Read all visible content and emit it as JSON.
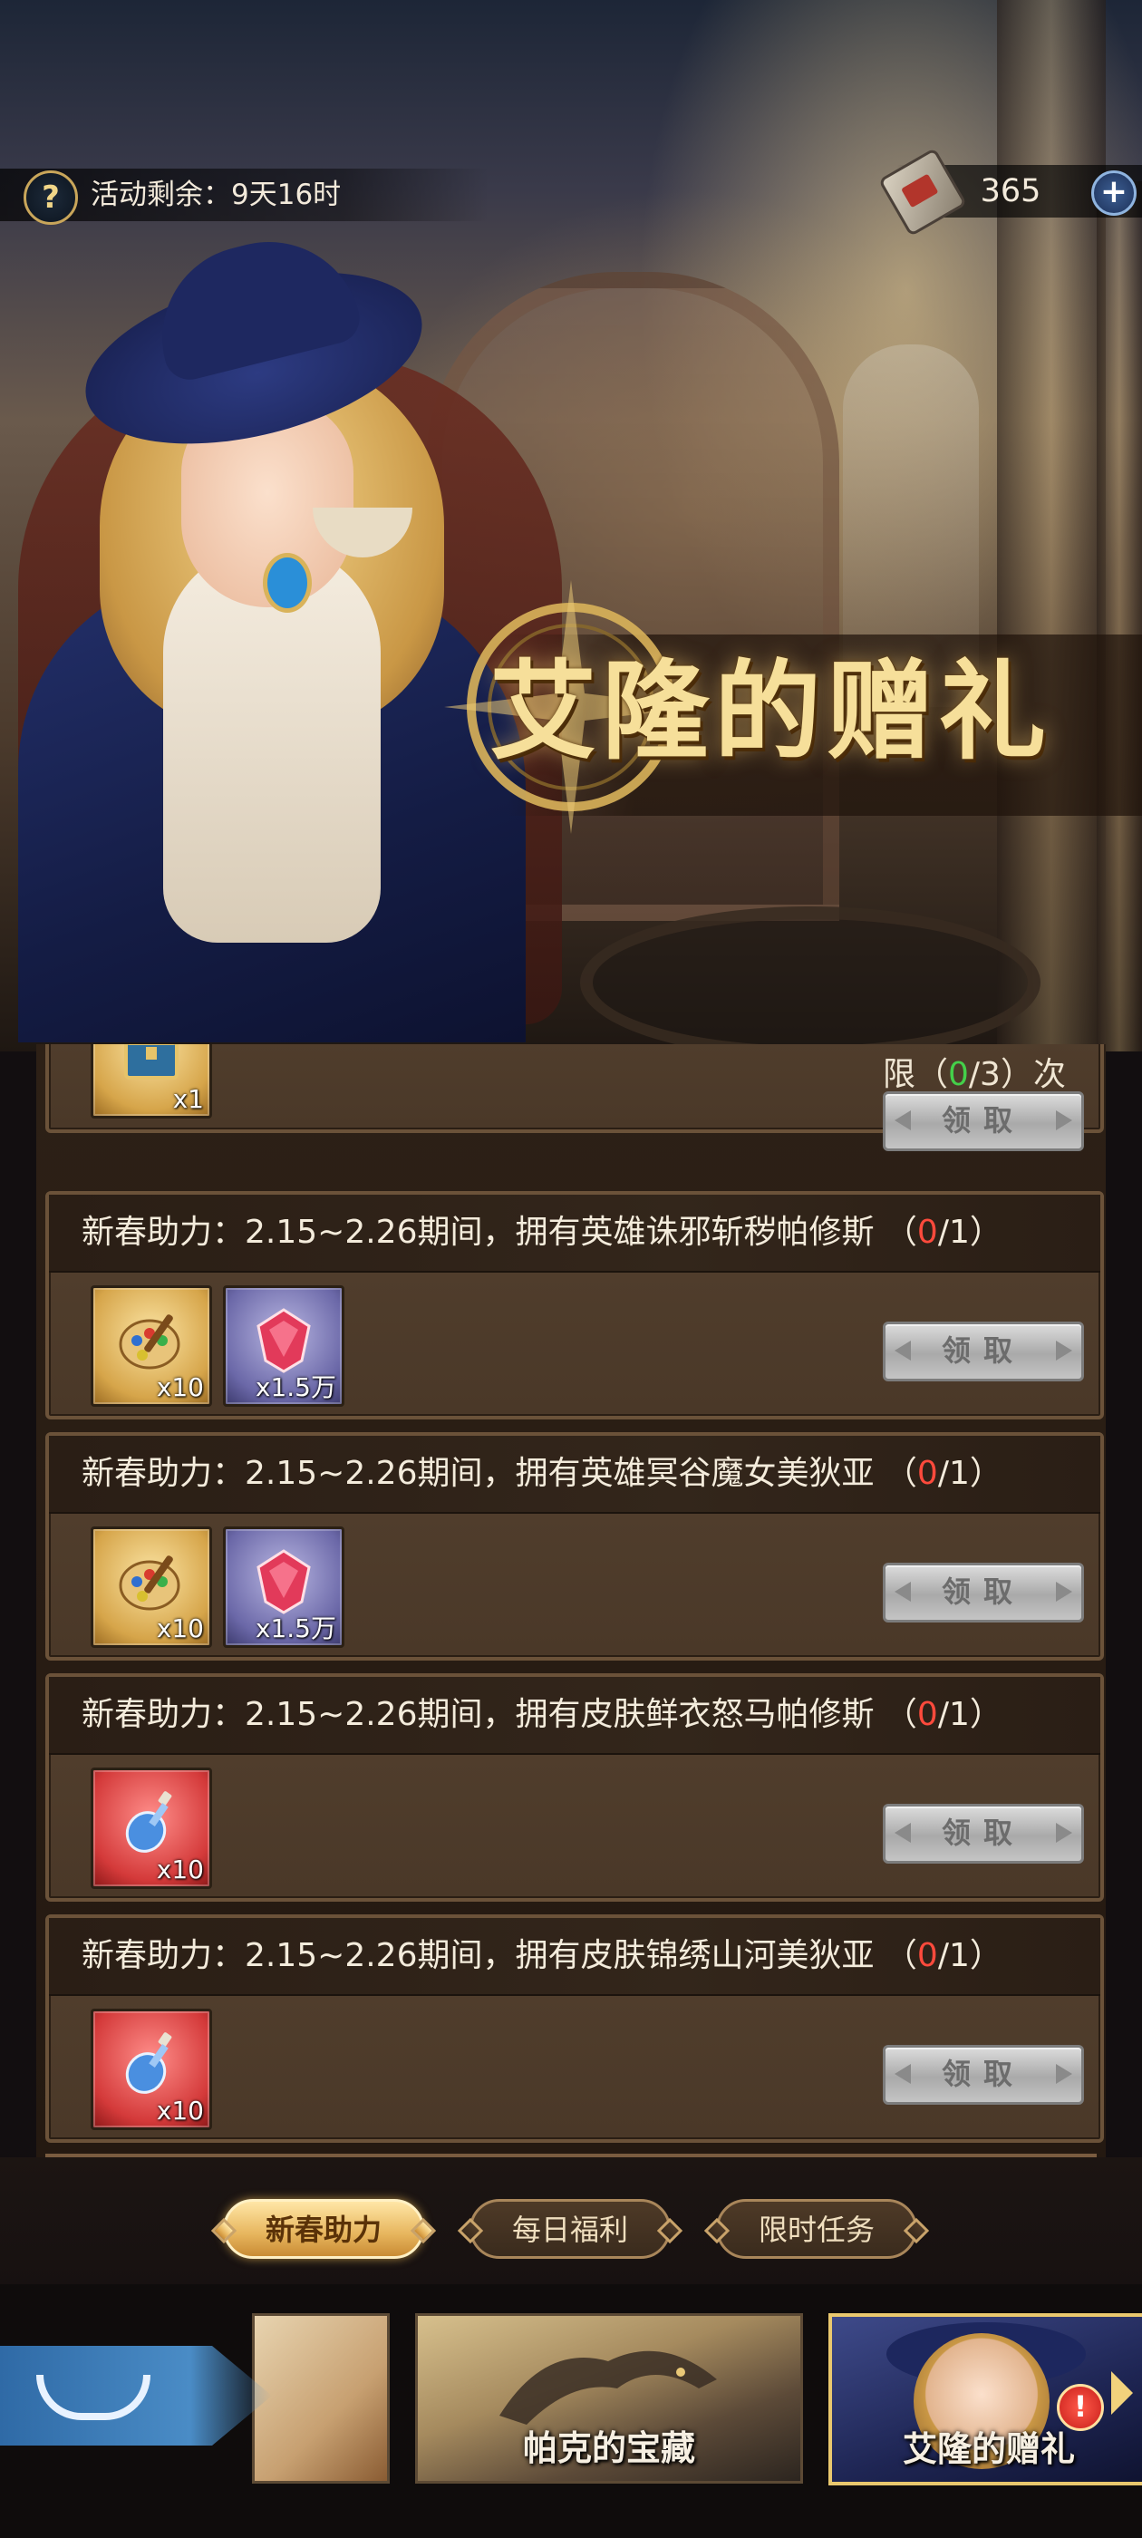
{
  "header": {
    "help_icon": "question-icon",
    "time_remaining": "活动剩余：9天16时",
    "currency_icon": "book-icon",
    "currency_value": "365",
    "add_icon": "plus-icon"
  },
  "banner": {
    "title": "艾隆的赠礼"
  },
  "tasks": [
    {
      "limit_prefix": "限（",
      "limit_cur": "0",
      "limit_suffix": "/3）次",
      "items": [
        {
          "icon": "treasure-chest-icon",
          "qty": "x1"
        }
      ],
      "button": "领取"
    },
    {
      "title": "新春助力：2.15~2.26期间，拥有英雄诛邪斩秽帕修斯 （",
      "progress_cur": "0",
      "progress_rest": "/1）",
      "items": [
        {
          "icon": "paint-palette-icon",
          "qty": "x10"
        },
        {
          "icon": "red-gem-icon",
          "qty": "x1.5万"
        }
      ],
      "button": "领取"
    },
    {
      "title": "新春助力：2.15~2.26期间，拥有英雄冥谷魔女美狄亚 （",
      "progress_cur": "0",
      "progress_rest": "/1）",
      "items": [
        {
          "icon": "paint-palette-icon",
          "qty": "x10"
        },
        {
          "icon": "red-gem-icon",
          "qty": "x1.5万"
        }
      ],
      "button": "领取"
    },
    {
      "title": "新春助力：2.15~2.26期间，拥有皮肤鲜衣怒马帕修斯 （",
      "progress_cur": "0",
      "progress_rest": "/1）",
      "items": [
        {
          "icon": "potion-bottle-icon",
          "qty": "x10"
        }
      ],
      "button": "领取"
    },
    {
      "title": "新春助力：2.15~2.26期间，拥有皮肤锦绣山河美狄亚 （",
      "progress_cur": "0",
      "progress_rest": "/1）",
      "items": [
        {
          "icon": "potion-bottle-icon",
          "qty": "x10"
        }
      ],
      "button": "领取"
    }
  ],
  "tabs": [
    {
      "label": "新春助力",
      "active": true
    },
    {
      "label": "每日福利",
      "active": false
    },
    {
      "label": "限时任务",
      "active": false
    }
  ],
  "bottom_banners": [
    {
      "label": "",
      "icon": "event-banner"
    },
    {
      "label": "帕克的宝藏",
      "icon": "dragon-banner"
    },
    {
      "label": "艾隆的赠礼",
      "icon": "heroine-banner",
      "alert": "!"
    }
  ],
  "colors": {
    "progress_zero": "#ff4a3c",
    "limit_zero": "#44d04a",
    "tab_active": "#e7b55d",
    "title_gold": "#f6df9a"
  }
}
